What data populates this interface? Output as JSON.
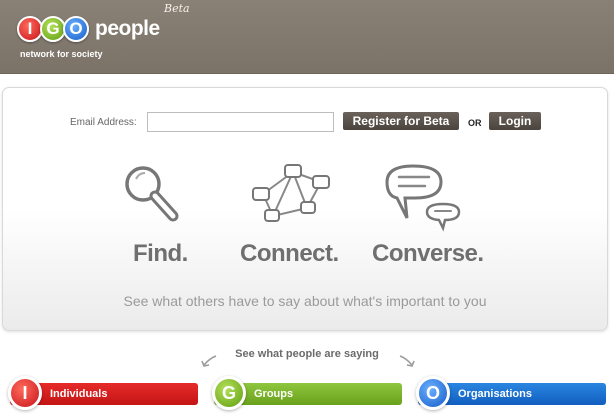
{
  "header": {
    "logo_letters": [
      "I",
      "G",
      "O"
    ],
    "logo_word": "people",
    "beta_tag": "Beta",
    "tagline": "network for society"
  },
  "signup": {
    "email_label": "Email Address:",
    "email_value": "",
    "register_label": "Register for Beta",
    "or_label": "OR",
    "login_label": "Login"
  },
  "features": [
    {
      "label": "Find.",
      "icon": "magnifier-icon"
    },
    {
      "label": "Connect.",
      "icon": "network-icon"
    },
    {
      "label": "Converse.",
      "icon": "speech-bubbles-icon"
    }
  ],
  "panel_footer": "See what others have to say about what's important to you",
  "people_section": {
    "heading": "See what people are saying",
    "categories": [
      {
        "letter": "I",
        "label": "Individuals",
        "color": "#d61f1f"
      },
      {
        "letter": "G",
        "label": "Groups",
        "color": "#7cb62e"
      },
      {
        "letter": "O",
        "label": "Organisations",
        "color": "#1a70d1"
      }
    ]
  },
  "colors": {
    "header_bg": "#857c72",
    "feature_text": "#6f6f6f",
    "button_bg": "#564f48"
  }
}
